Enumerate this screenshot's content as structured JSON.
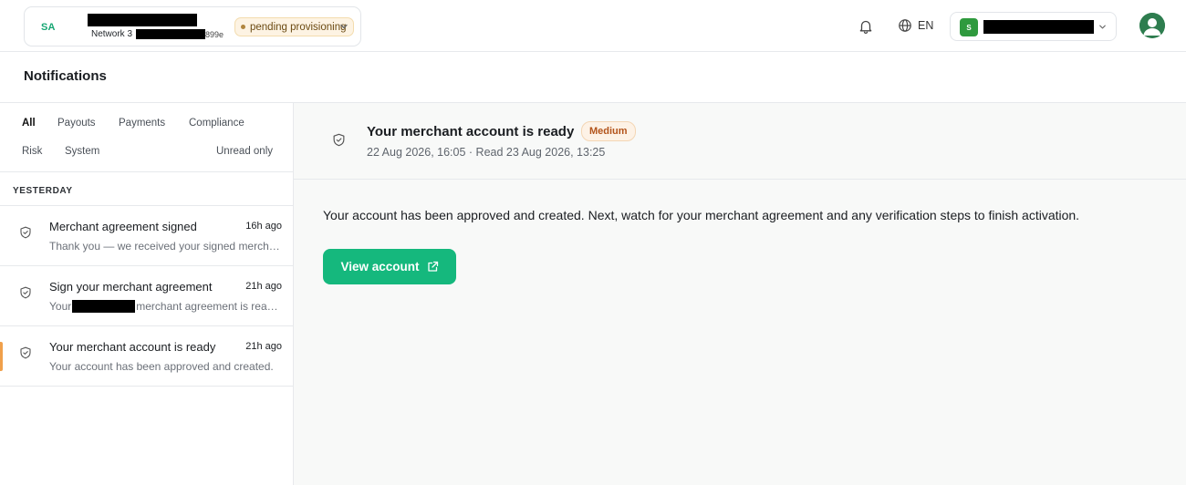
{
  "topbar": {
    "org": {
      "initials": "SA",
      "network_label": "Network 3",
      "id_suffix": "899e",
      "status": "pending provisioning"
    },
    "language": "EN",
    "account": {
      "badge": "S"
    }
  },
  "page": {
    "title": "Notifications"
  },
  "filters": {
    "tabs": [
      "All",
      "Payouts",
      "Payments",
      "Compliance",
      "Risk",
      "System"
    ],
    "unread_only": "Unread only"
  },
  "list": {
    "group_label": "YESTERDAY",
    "items": [
      {
        "title": "Merchant agreement signed",
        "time": "16h ago",
        "preview": "Thank you — we received your signed merchant agreement."
      },
      {
        "title": "Sign your merchant agreement",
        "time": "21h ago",
        "preview_prefix": "Your",
        "preview_suffix": "merchant agreement is ready for signature."
      },
      {
        "title": "Your merchant account is ready",
        "time": "21h ago",
        "preview": "Your account has been approved and created."
      }
    ]
  },
  "detail": {
    "title": "Your merchant account is ready",
    "priority": "Medium",
    "meta": "22 Aug 2026, 16:05 · Read 23 Aug 2026, 13:25",
    "body": "Your account has been approved and created. Next, watch for your merchant agreement and any verification steps to finish activation.",
    "cta_label": "View account"
  },
  "colors": {
    "accent": "#15b87d",
    "selected_marker": "#f0a04b",
    "priority_text": "#b3541b"
  }
}
